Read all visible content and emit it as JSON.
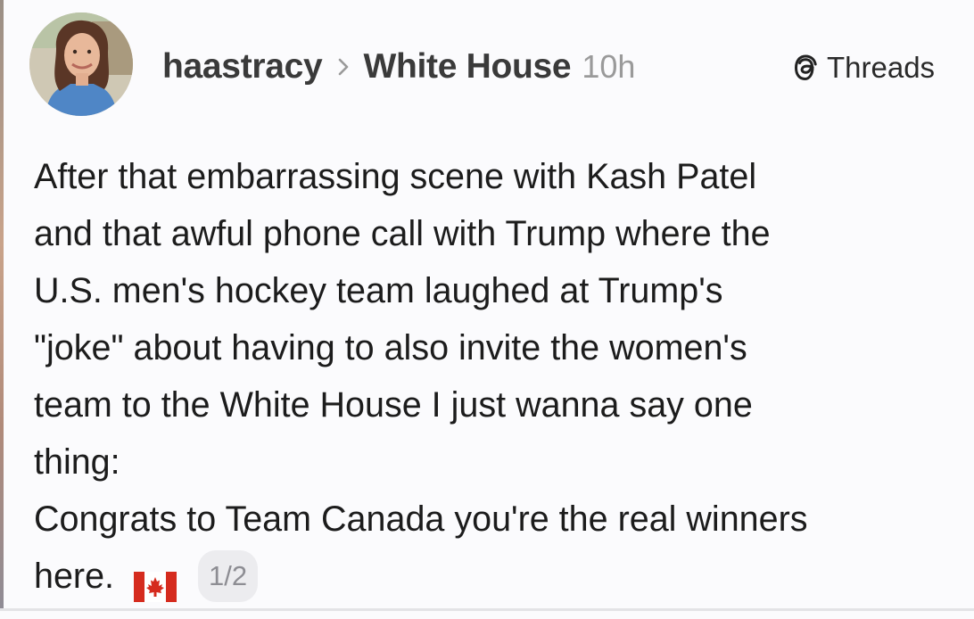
{
  "post": {
    "author": "haastracy",
    "community": "White House",
    "time": "10h",
    "brand": "Threads",
    "lines": [
      "After that embarrassing scene with Kash Patel",
      "and that awful phone call with Trump where the",
      "U.S. men's hockey team laughed at Trump's",
      "\"joke\" about having to also invite the women's",
      "team to the White House I just wanna say one",
      "thing:",
      "Congrats to Team Canada you're the real winners",
      "here."
    ],
    "flag_icon": "canada-flag-emoji",
    "page_indicator": "1/2"
  },
  "colors": {
    "background": "#fbfbfd",
    "text": "#1c1c1c",
    "muted": "#9a9a9a",
    "badge_bg": "#ececef",
    "flag_red": "#d52b1e"
  }
}
